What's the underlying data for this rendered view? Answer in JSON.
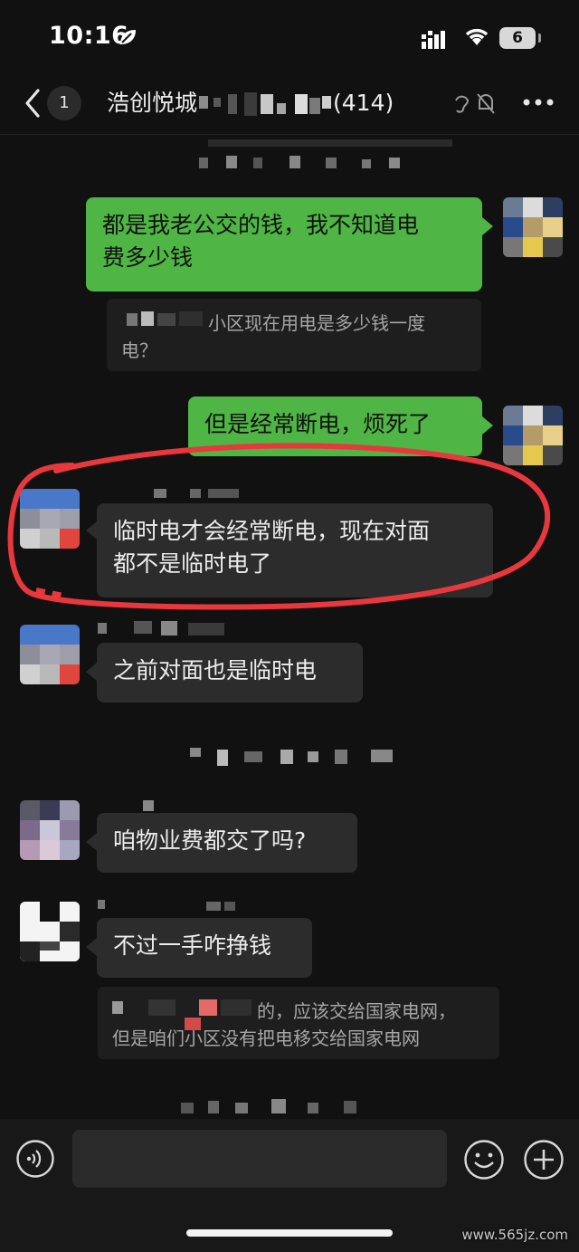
{
  "status_bar": {
    "time": "10:16",
    "battery": "6"
  },
  "nav": {
    "unread_count": "1",
    "title_prefix": "浩创悦城",
    "title_suffix": "(414)"
  },
  "messages": [
    {
      "id": "m1",
      "side": "right",
      "text_line1": "都是我老公交的钱，我不知道电",
      "text_line2": "费多少钱"
    },
    {
      "id": "q1",
      "type": "quote",
      "text_line1": "小区现在用电是多少钱一度",
      "text_line2": "电？"
    },
    {
      "id": "m2",
      "side": "right",
      "text": "但是经常断电，烦死了"
    },
    {
      "id": "m3",
      "side": "left",
      "text_line1": "临时电才会经常断电，现在对面",
      "text_line2": "都不是临时电了",
      "highlighted": true
    },
    {
      "id": "m4",
      "side": "left",
      "text": "之前对面也是临时电"
    },
    {
      "id": "m5",
      "side": "left",
      "text": "咱物业费都交了吗?"
    },
    {
      "id": "m6",
      "side": "left",
      "text": "不过一手咋挣钱"
    },
    {
      "id": "q2",
      "type": "quote",
      "text_line1": "的，应该交给国家电网，",
      "text_line2": "但是咱们小区没有把电移交给国家电网"
    }
  ],
  "highlight_color": "#e8383d",
  "accent_green": "#4fb544",
  "icons": [
    "leaf-icon",
    "signal-icon",
    "wifi-icon",
    "battery-icon",
    "back-arrow-icon",
    "ear-icon",
    "mute-bell-icon",
    "more-icon",
    "voice-icon",
    "emoji-icon",
    "plus-icon"
  ],
  "watermark": "www.565jz.com"
}
